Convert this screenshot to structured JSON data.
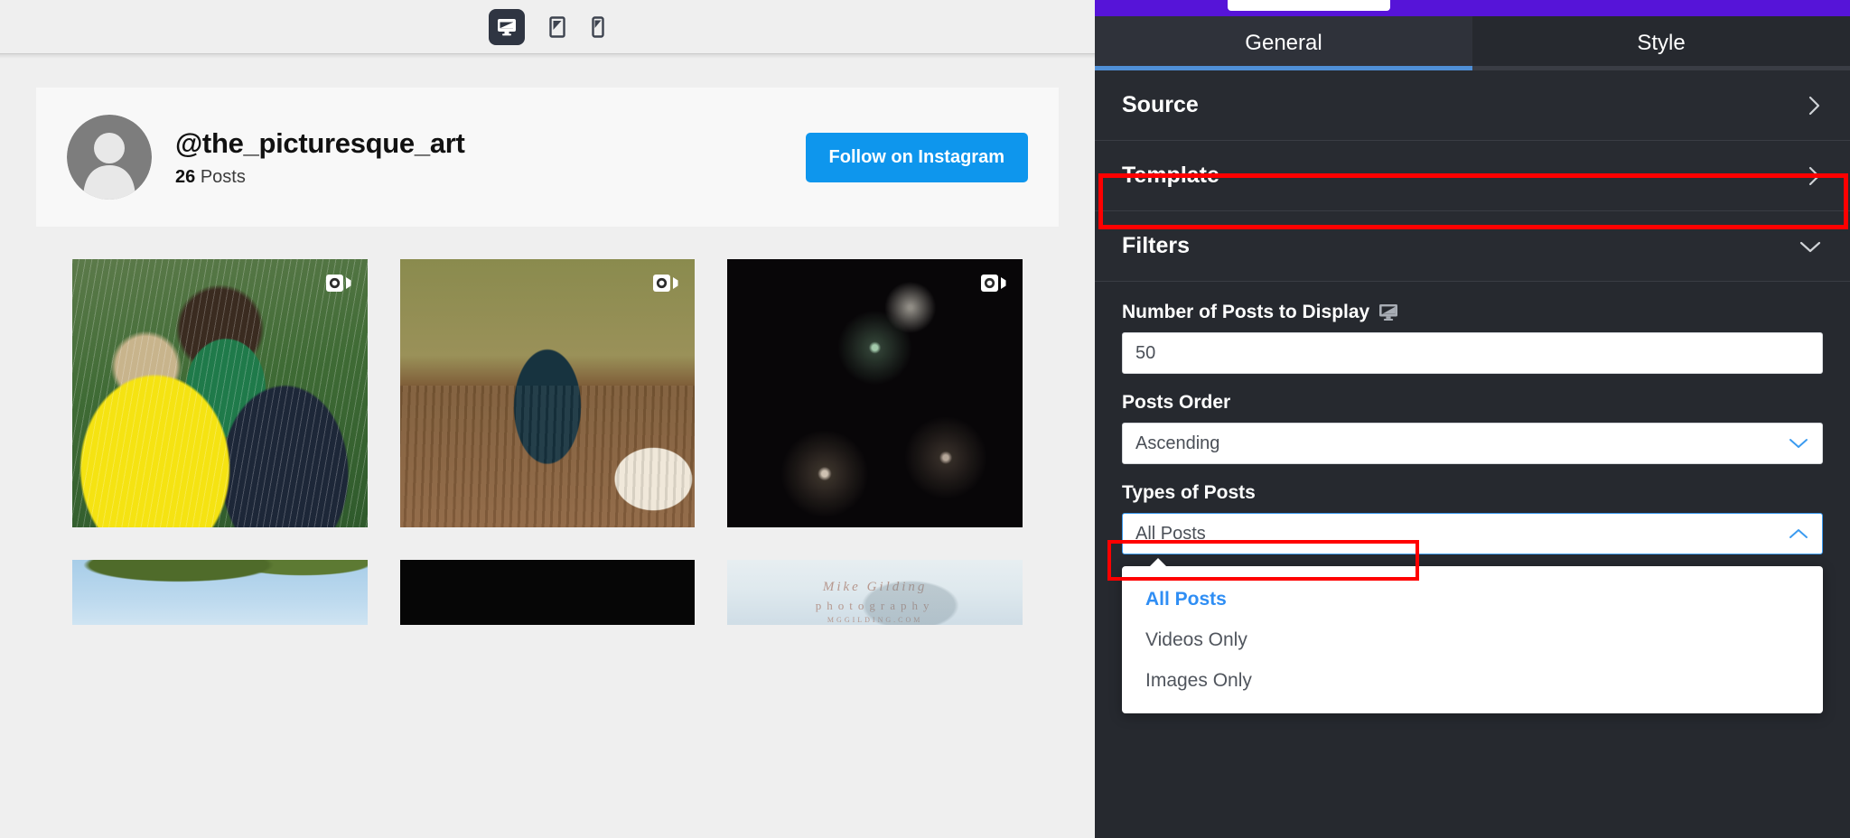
{
  "preview": {
    "device_toolbar": {
      "devices": [
        {
          "name": "desktop",
          "label": "Desktop",
          "active": true
        },
        {
          "name": "tablet",
          "label": "Tablet",
          "active": false
        },
        {
          "name": "mobile",
          "label": "Mobile",
          "active": false
        }
      ]
    },
    "profile": {
      "handle": "@the_picturesque_art",
      "posts_count": "26",
      "posts_word": "Posts",
      "follow_button": "Follow on Instagram",
      "follow_button_color": "#0e96ed",
      "avatar_icon": "default-user-avatar"
    },
    "grid": {
      "tiles": [
        {
          "art": "art-rain",
          "badge": "video-camera-icon",
          "has_badge": true
        },
        {
          "art": "art-coffee",
          "badge": "video-camera-icon",
          "has_badge": true
        },
        {
          "art": "art-fireworks",
          "badge": "video-camera-icon",
          "has_badge": true
        },
        {
          "art": "art-tree",
          "badge": "",
          "has_badge": false
        },
        {
          "art": "art-black",
          "badge": "",
          "has_badge": false
        },
        {
          "art": "art-watermark",
          "badge": "",
          "has_badge": false
        }
      ],
      "watermark": {
        "line1": "Mike Gilding",
        "line2": "photography",
        "line3": "MGGILDING.COM"
      }
    }
  },
  "sidebar": {
    "topbar_color": "#5614d8",
    "tabs": [
      {
        "label": "General",
        "active": true
      },
      {
        "label": "Style",
        "active": false
      }
    ],
    "sections": [
      {
        "label": "Source",
        "state": "collapsed",
        "chevron": "chevron-right-icon"
      },
      {
        "label": "Template",
        "state": "collapsed",
        "chevron": "chevron-right-icon"
      },
      {
        "label": "Filters",
        "state": "expanded",
        "chevron": "chevron-down-icon",
        "highlighted": true
      }
    ],
    "filters": {
      "number_of_posts": {
        "label": "Number of Posts to Display",
        "value": "50",
        "responsive_icon": "desktop-monitor-icon"
      },
      "posts_order": {
        "label": "Posts Order",
        "value": "Ascending",
        "caret": "chevron-down-icon"
      },
      "types_of_posts": {
        "label": "Types of Posts",
        "value": "All Posts",
        "caret": "chevron-up-icon",
        "open": true,
        "options": [
          {
            "label": "All Posts",
            "selected": true,
            "highlighted": false
          },
          {
            "label": "Videos Only",
            "selected": false,
            "highlighted": true
          },
          {
            "label": "Images Only",
            "selected": false,
            "highlighted": false
          }
        ]
      }
    },
    "annotation_color": "#ff0000"
  }
}
